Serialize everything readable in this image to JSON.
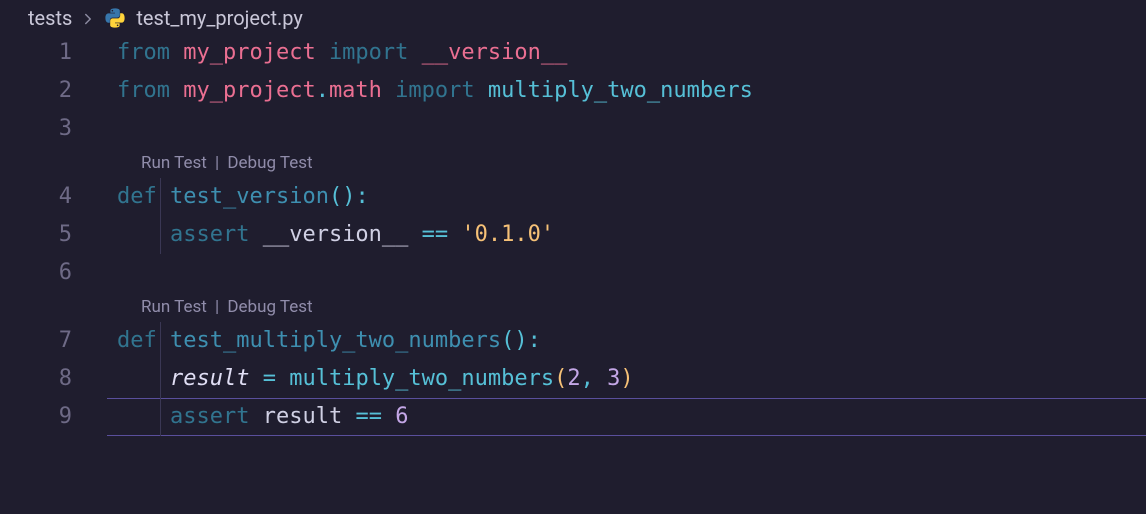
{
  "breadcrumbs": {
    "folder": "tests",
    "file": "test_my_project.py"
  },
  "codelens": {
    "run": "Run Test",
    "debug": "Debug Test",
    "sep": "|"
  },
  "lines": {
    "l1": {
      "num": "1"
    },
    "l2": {
      "num": "2"
    },
    "l3": {
      "num": "3"
    },
    "l4": {
      "num": "4"
    },
    "l5": {
      "num": "5"
    },
    "l6": {
      "num": "6"
    },
    "l7": {
      "num": "7"
    },
    "l8": {
      "num": "8"
    },
    "l9": {
      "num": "9"
    }
  },
  "tok": {
    "from": "from",
    "import": "import",
    "def": "def",
    "assert": "assert",
    "my_project": "my_project",
    "dot": ".",
    "math": "math",
    "version": "__version__",
    "multiply": "multiply_two_numbers",
    "test_version": "test_version",
    "test_multiply": "test_multiply_two_numbers",
    "result": "result",
    "eq": "=",
    "deq": "==",
    "v010": "'0.1.0'",
    "n2": "2",
    "n3": "3",
    "n6": "6",
    "colon": ":",
    "lpar": "(",
    "rpar": ")",
    "comma": ", "
  }
}
